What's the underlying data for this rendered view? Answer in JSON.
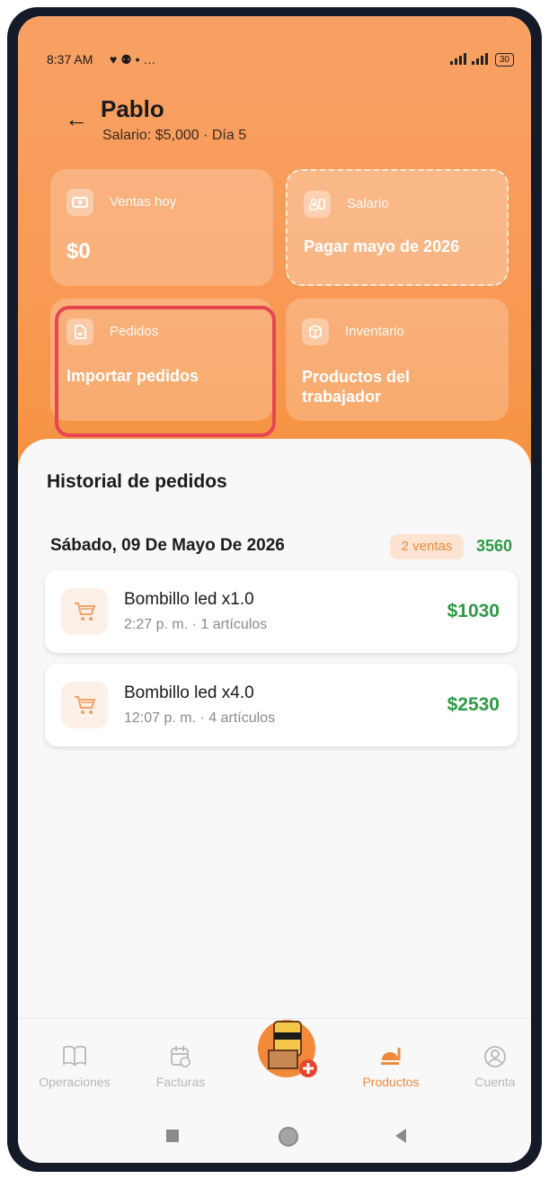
{
  "status_bar": {
    "time": "8:37 AM",
    "extra": "♥ ⚉ • …",
    "battery": "30"
  },
  "header": {
    "back_label": "←",
    "name": "Pablo",
    "subtitle": "Salario: $5,000 · Día 5"
  },
  "cards": [
    {
      "label": "Ventas hoy",
      "value": "$0",
      "icon": "money-icon"
    },
    {
      "label": "Salario",
      "value": "Pagar mayo de 2026",
      "icon": "id-card-icon"
    },
    {
      "label": "Pedidos",
      "value": "Importar pedidos",
      "icon": "file-icon"
    },
    {
      "label": "Inventario",
      "value_line1": "Productos del",
      "value_line2": "trabajador",
      "icon": "box-icon"
    }
  ],
  "history": {
    "title": "Historial de pedidos",
    "date": "Sábado, 09 De Mayo De 2026",
    "sales_badge": "2 ventas",
    "total": "3560",
    "orders": [
      {
        "title": "Bombillo led x1.0",
        "meta": "2:27 p. m. · 1 artículos",
        "amount": "$1030"
      },
      {
        "title": "Bombillo led x4.0",
        "meta": "12:07 p. m. · 4 artículos",
        "amount": "$2530"
      }
    ]
  },
  "nav": {
    "items": [
      {
        "label": "Operaciones",
        "icon": "book-icon"
      },
      {
        "label": "Facturas",
        "icon": "calendar-icon"
      },
      {
        "label": "Productos",
        "icon": "food-icon",
        "active": true
      },
      {
        "label": "Cuenta",
        "icon": "user-icon"
      }
    ]
  },
  "colors": {
    "accent": "#f08a3c",
    "green": "#2e9a45",
    "highlight": "#e64553"
  }
}
